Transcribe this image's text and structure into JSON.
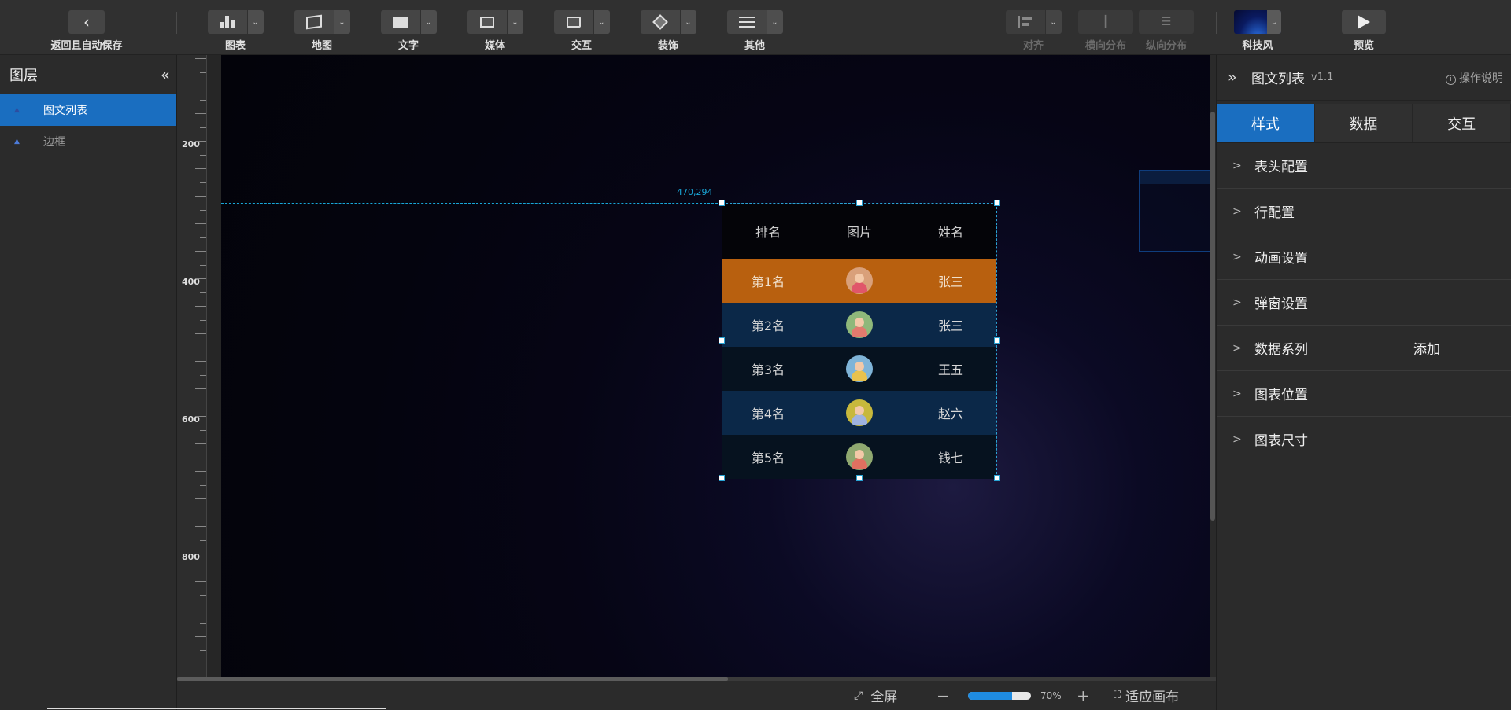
{
  "toolbar": {
    "back": {
      "label": "返回且自动保存",
      "icon": "chevron-left-icon"
    },
    "groups": [
      {
        "label": "图表",
        "icon": "bar-chart-icon"
      },
      {
        "label": "地图",
        "icon": "map-icon"
      },
      {
        "label": "文字",
        "icon": "text-icon"
      },
      {
        "label": "媒体",
        "icon": "media-icon"
      },
      {
        "label": "交互",
        "icon": "interaction-icon"
      },
      {
        "label": "装饰",
        "icon": "decoration-icon"
      },
      {
        "label": "其他",
        "icon": "other-icon"
      }
    ],
    "align": {
      "label": "对齐"
    },
    "h_distribute": {
      "label": "横向分布"
    },
    "v_distribute": {
      "label": "纵向分布"
    },
    "theme": {
      "label": "科技风"
    },
    "preview": {
      "label": "预览",
      "icon": "play-icon"
    }
  },
  "layers": {
    "title": "图层",
    "collapse_icon": "double-chevron-left-icon",
    "items": [
      {
        "label": "图文列表",
        "icon": "layer-icon",
        "active": true
      },
      {
        "label": "边框",
        "icon": "layer-icon",
        "active": false
      }
    ]
  },
  "ruler": {
    "labels": [
      "200",
      "400",
      "600",
      "800"
    ]
  },
  "canvas": {
    "coord_label": "470,294",
    "list_widget": {
      "headers": [
        "排名",
        "图片",
        "姓名"
      ],
      "rows": [
        {
          "rank": "第1名",
          "name": "张三",
          "avatar_bg": "#d9a07a",
          "avatar_body": "#e0566a"
        },
        {
          "rank": "第2名",
          "name": "张三",
          "avatar_bg": "#8fb87a",
          "avatar_body": "#e27a6e"
        },
        {
          "rank": "第3名",
          "name": "王五",
          "avatar_bg": "#7fb4d8",
          "avatar_body": "#e9c24e"
        },
        {
          "rank": "第4名",
          "name": "赵六",
          "avatar_bg": "#c7b83c",
          "avatar_body": "#9fb3e0"
        },
        {
          "rank": "第5名",
          "name": "钱七",
          "avatar_bg": "#8fa870",
          "avatar_body": "#e07060"
        }
      ],
      "colors": {
        "highlight_row": "#b8600f",
        "odd_row": "#0b2848",
        "even_row": "#06121f",
        "header": "#040408"
      }
    }
  },
  "props": {
    "title": "图文列表",
    "version": "v1.1",
    "help": "操作说明",
    "tabs": [
      "样式",
      "数据",
      "交互"
    ],
    "active_tab": "样式",
    "sections": [
      {
        "label": "表头配置"
      },
      {
        "label": "行配置"
      },
      {
        "label": "动画设置"
      },
      {
        "label": "弹窗设置"
      },
      {
        "label": "数据系列",
        "action": "添加"
      },
      {
        "label": "图表位置"
      },
      {
        "label": "图表尺寸"
      }
    ]
  },
  "status": {
    "fullscreen": "全屏",
    "zoom_text": "70%",
    "zoom_fraction": 0.7,
    "fit": "适应画布"
  },
  "accent_color": "#1a6ec0"
}
